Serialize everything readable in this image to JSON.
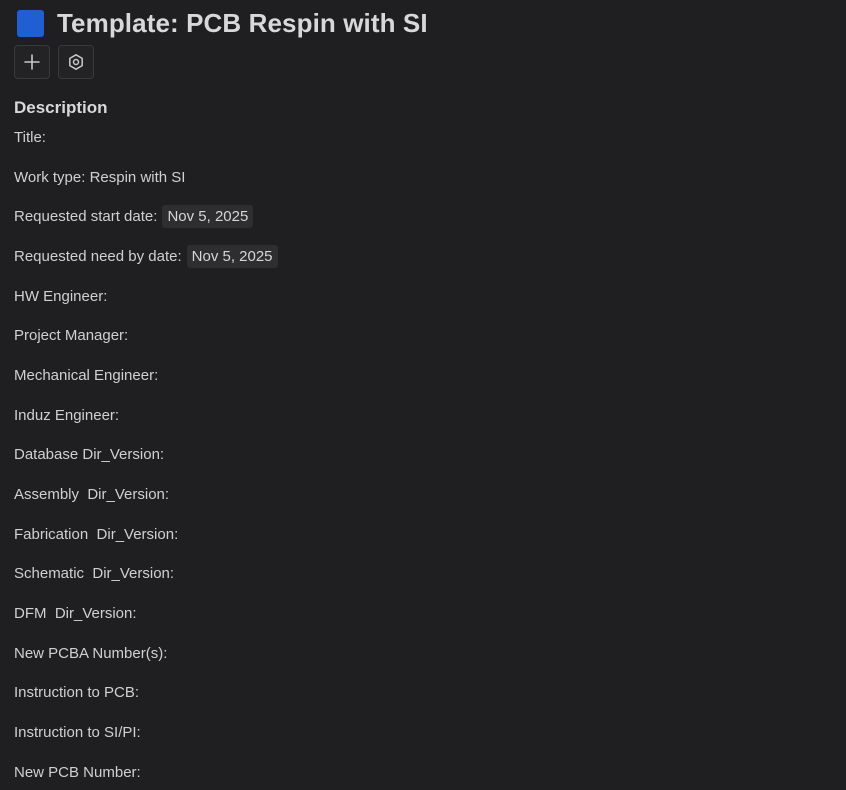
{
  "header": {
    "title": "Template: PCB Respin with SI",
    "type_color": "#1f5fd1"
  },
  "toolbar": {
    "add_icon": "plus-icon",
    "settings_icon": "settings-icon"
  },
  "description": {
    "heading": "Description",
    "fields": [
      {
        "label": "Title:"
      },
      {
        "label": "Work type: Respin with SI"
      },
      {
        "label": "Requested start date:",
        "date": "Nov 5, 2025"
      },
      {
        "label": "Requested need by date:",
        "date": "Nov 5, 2025"
      },
      {
        "label": "HW Engineer:"
      },
      {
        "label": "Project Manager:"
      },
      {
        "label": "Mechanical Engineer:"
      },
      {
        "label": "Induz Engineer:"
      },
      {
        "label": "Database Dir_Version:"
      },
      {
        "label": "Assembly  Dir_Version:"
      },
      {
        "label": "Fabrication  Dir_Version:"
      },
      {
        "label": "Schematic  Dir_Version:"
      },
      {
        "label": "DFM  Dir_Version:"
      },
      {
        "label": "New PCBA Number(s):"
      },
      {
        "label": "Instruction to PCB:"
      },
      {
        "label": "Instruction to SI/PI:"
      },
      {
        "label": "New PCB Number:"
      }
    ]
  }
}
